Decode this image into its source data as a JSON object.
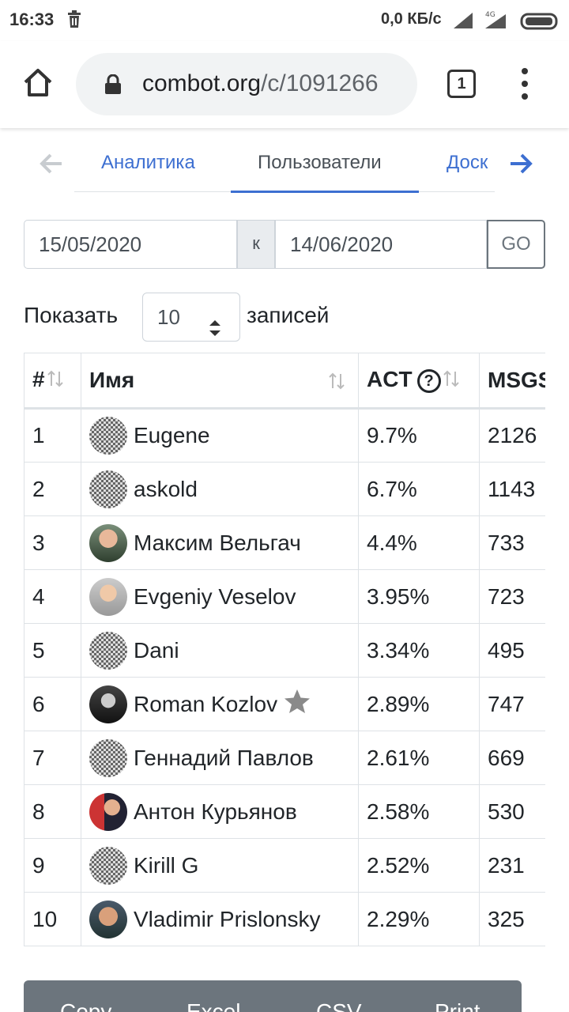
{
  "status": {
    "time": "16:33",
    "speed": "0,0 КБ/с",
    "network": "4G"
  },
  "browser": {
    "url_domain": "combot.org",
    "url_path": "/c/1091266",
    "tabs_count": "1"
  },
  "nav": {
    "tabs": [
      "Аналитика",
      "Пользователи",
      "Доск"
    ],
    "active": "Пользователи"
  },
  "filters": {
    "date_from": "15/05/2020",
    "separator": "к",
    "date_to": "14/06/2020",
    "go_label": "GO"
  },
  "entries": {
    "prefix": "Показать",
    "value": "10",
    "suffix": "записей"
  },
  "table": {
    "headers": [
      "#",
      "Имя",
      "ACT",
      "MSGS"
    ],
    "help_mark": "?",
    "rows": [
      {
        "num": "1",
        "name": "Eugene",
        "act": "9.7%",
        "msgs": "2126"
      },
      {
        "num": "2",
        "name": "askold",
        "act": "6.7%",
        "msgs": "1143"
      },
      {
        "num": "3",
        "name": "Максим Вельгач",
        "act": "4.4%",
        "msgs": "733"
      },
      {
        "num": "4",
        "name": "Evgeniy Veselov",
        "act": "3.95%",
        "msgs": "723"
      },
      {
        "num": "5",
        "name": "Dani",
        "act": "3.34%",
        "msgs": "495"
      },
      {
        "num": "6",
        "name": "Roman Kozlov",
        "act": "2.89%",
        "msgs": "747"
      },
      {
        "num": "7",
        "name": "Геннадий Павлов",
        "act": "2.61%",
        "msgs": "669"
      },
      {
        "num": "8",
        "name": "Антон Курьянов",
        "act": "2.58%",
        "msgs": "530"
      },
      {
        "num": "9",
        "name": "Kirill G",
        "act": "2.52%",
        "msgs": "231"
      },
      {
        "num": "10",
        "name": "Vladimir Prislonsky",
        "act": "2.29%",
        "msgs": "325"
      }
    ]
  },
  "export": {
    "buttons": [
      "Copy",
      "Excel",
      "CSV",
      "Print"
    ]
  },
  "colors": {
    "accent": "#3d6fd1",
    "button_gray": "#6c757d",
    "star": "#8a8a8a"
  }
}
